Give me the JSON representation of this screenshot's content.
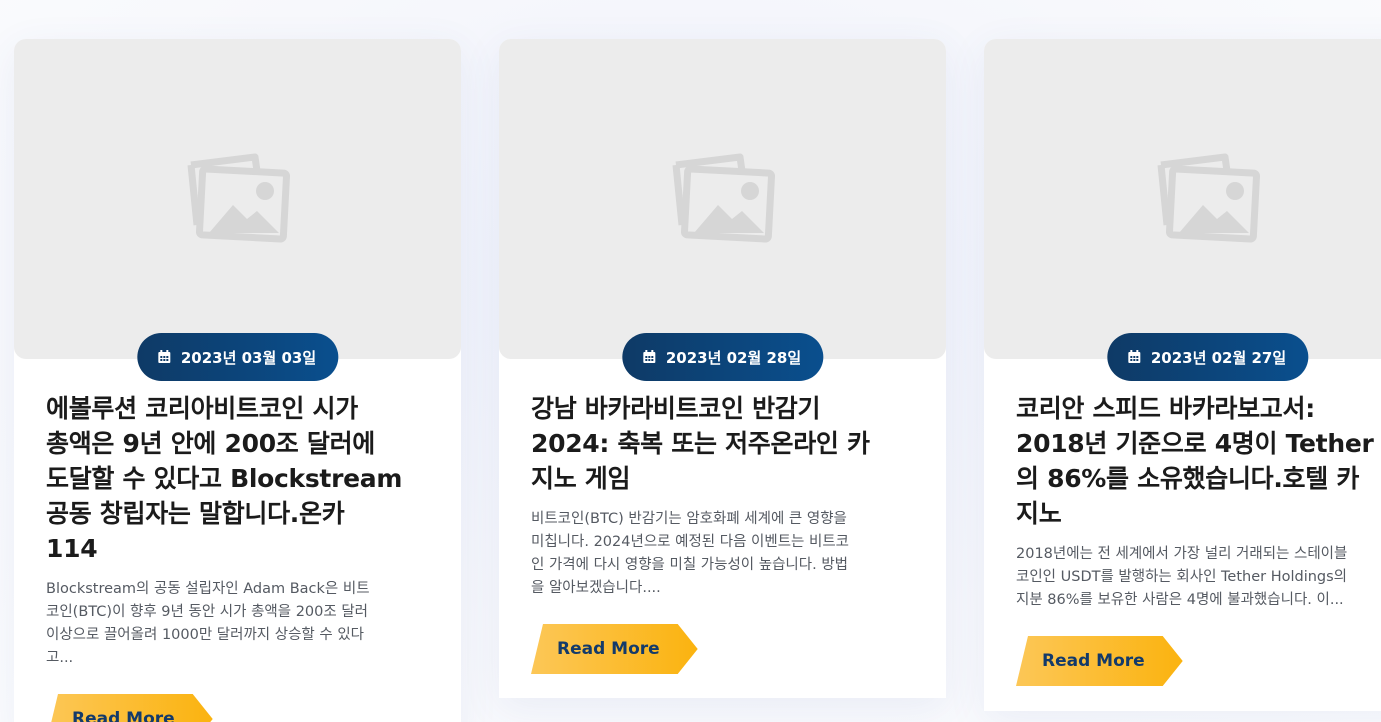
{
  "posts": [
    {
      "date": "2023년 03월 03일",
      "title_lines": [
        "에볼루션 코리아비트코인 시가",
        "총액은 9년 안에 200조 달러에",
        "도달할 수 있다고 Blockstream",
        "공동 창립자는 말합니다.온카",
        "114"
      ],
      "excerpt_lines": [
        "Blockstream의 공동 설립자인 Adam Back은 비트",
        "코인(BTC)이 향후 9년 동안 시가 총액을 200조 달러",
        "이상으로 끌어올려 1000만 달러까지 상승할 수 있다",
        "고..."
      ],
      "read_more": "Read More",
      "image_icon": "image-placeholder-icon",
      "date_icon": "calendar-icon"
    },
    {
      "date": "2023년 02월 28일",
      "title_lines": [
        "강남 바카라비트코인 반감기",
        "2024: 축복 또는 저주온라인 카",
        "지노 게임"
      ],
      "excerpt_lines": [
        "비트코인(BTC) 반감기는 암호화폐 세계에 큰 영향을",
        "미칩니다. 2024년으로 예정된 다음 이벤트는 비트코",
        "인 가격에 다시 영향을 미칠 가능성이 높습니다. 방법",
        "을 알아보겠습니다...."
      ],
      "read_more": "Read More",
      "image_icon": "image-placeholder-icon",
      "date_icon": "calendar-icon"
    },
    {
      "date": "2023년 02월 27일",
      "title_lines": [
        "코리안 스피드 바카라보고서:",
        "2018년 기준으로 4명이 Tether",
        "의 86%를 소유했습니다.호텔 카",
        "지노"
      ],
      "excerpt_lines": [
        "2018년에는 전 세계에서 가장 널리 거래되는 스테이블",
        "코인인 USDT를 발행하는 회사인 Tether Holdings의",
        "지분 86%를 보유한 사람은 4명에 불과했습니다. 이..."
      ],
      "read_more": "Read More",
      "image_icon": "image-placeholder-icon",
      "date_icon": "calendar-icon"
    }
  ],
  "colors": {
    "badge": "#0e3a66",
    "button": "#fbb30f",
    "button_text": "#133a6a",
    "placeholder": "#ececec"
  }
}
